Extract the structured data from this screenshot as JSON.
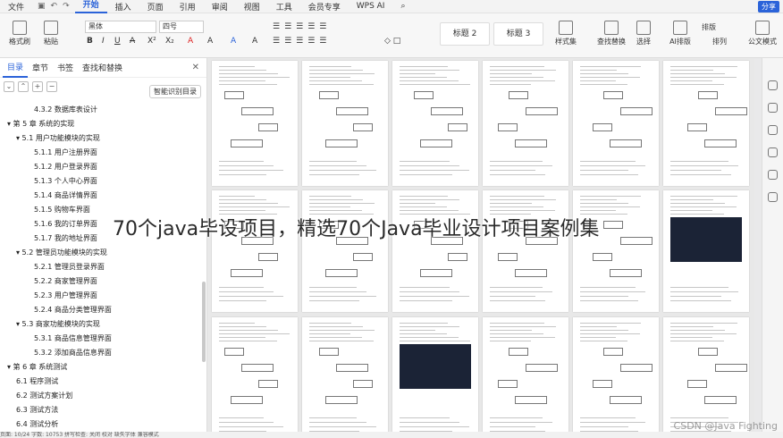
{
  "menu": {
    "file": "文件",
    "tabs": [
      "开始",
      "插入",
      "页面",
      "引用",
      "审阅",
      "视图",
      "工具",
      "会员专享"
    ],
    "active": "开始",
    "wps_ai": "WPS AI",
    "share": "分享"
  },
  "ribbon": {
    "format_painter": "格式刷",
    "paste": "粘贴",
    "font": "黑体",
    "size": "四号",
    "style1": "标题 2",
    "style2": "标题 3",
    "styles": "样式集",
    "find": "查找替换",
    "select": "选择",
    "ai_layout": "AI排版",
    "layout": "排版",
    "sort": "排列",
    "formula": "公文模式"
  },
  "panel": {
    "tabs": [
      "目录",
      "章节",
      "书签",
      "查找和替换"
    ],
    "active": "目录",
    "smart": "智能识别目录",
    "toc": [
      {
        "t": "4.3.2 数据库表设计",
        "l": 3
      },
      {
        "t": "第 5 章 系统的实现",
        "l": 1
      },
      {
        "t": "5.1 用户功能模块的实现",
        "l": 2
      },
      {
        "t": "5.1.1 用户注册界面",
        "l": 3
      },
      {
        "t": "5.1.2 用户登录界面",
        "l": 3
      },
      {
        "t": "5.1.3 个人中心界面",
        "l": 3
      },
      {
        "t": "5.1.4 商品详情界面",
        "l": 3
      },
      {
        "t": "5.1.5 购物车界面",
        "l": 3
      },
      {
        "t": "5.1.6 我的订单界面",
        "l": 3
      },
      {
        "t": "5.1.7 我的地址界面",
        "l": 3
      },
      {
        "t": "5.2 管理员功能模块的实现",
        "l": 2
      },
      {
        "t": "5.2.1 管理员登录界面",
        "l": 3
      },
      {
        "t": "5.2.2 商家管理界面",
        "l": 3
      },
      {
        "t": "5.2.3 用户管理界面",
        "l": 3
      },
      {
        "t": "5.2.4 商品分类管理界面",
        "l": 3
      },
      {
        "t": "5.3 商家功能模块的实现",
        "l": 2
      },
      {
        "t": "5.3.1 商品信息管理界面",
        "l": 3
      },
      {
        "t": "5.3.2 添加商品信息界面",
        "l": 3
      },
      {
        "t": "第 6 章 系统测试",
        "l": 1
      },
      {
        "t": "6.1 程序测试",
        "l": 2
      },
      {
        "t": "6.2 测试方案计划",
        "l": 2
      },
      {
        "t": "6.3 测试方法",
        "l": 2
      },
      {
        "t": "6.4 测试分析",
        "l": 2
      }
    ]
  },
  "overlay_title": "70个java毕设项目，精选70个Java毕业设计项目案例集",
  "watermark": "CSDN @Java Fighting",
  "status": "页面: 10/24   字数: 10753   拼写检查: 关闭   校对   缺失字体   兼容模式"
}
